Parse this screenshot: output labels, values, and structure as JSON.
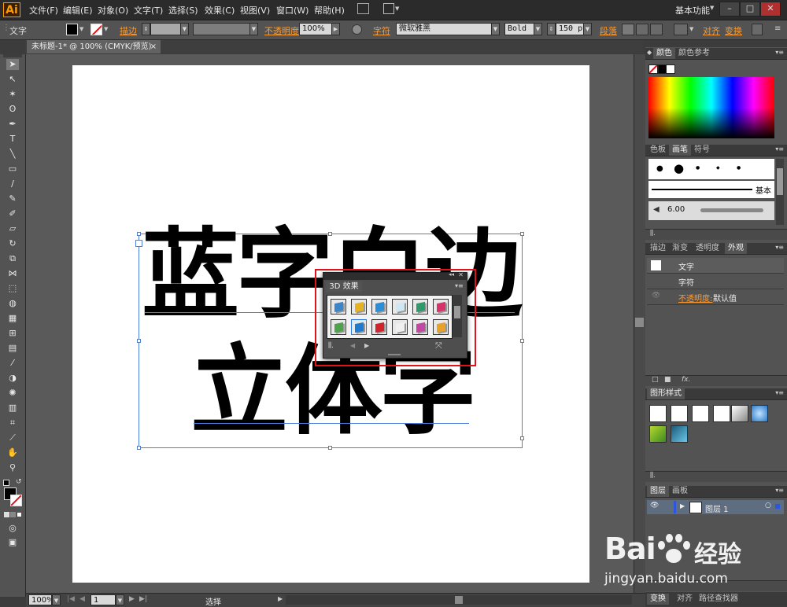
{
  "app": {
    "logo": "Ai",
    "menu": [
      "文件(F)",
      "编辑(E)",
      "对象(O)",
      "文字(T)",
      "选择(S)",
      "效果(C)",
      "视图(V)",
      "窗口(W)",
      "帮助(H)"
    ],
    "workspace": "基本功能",
    "window_buttons": [
      "–",
      "□",
      "✕"
    ]
  },
  "control_bar": {
    "type_label": "文字",
    "stroke_label": "描边",
    "opacity_label": "不透明度",
    "opacity_value": "100%",
    "char_label": "字符",
    "font_family": "微软雅黑",
    "font_style": "Bold",
    "font_size": "150 pt",
    "paragraph_label": "段落",
    "align_label": "对齐",
    "transform_label": "变换"
  },
  "document": {
    "tab_title": "未标题-1* @ 100% (CMYK/预览)",
    "tab_close": "×",
    "line1": "蓝字白边",
    "line2": "立体字"
  },
  "panel_3d": {
    "title": "3D 效果",
    "collapse": "◂◂",
    "close": "✕",
    "menu": "▾≡",
    "swatch_colors": [
      "#3a86c8",
      "#e3b321",
      "#2a8fd6",
      "#cfe6f3",
      "#2e9a6a",
      "#d6336c",
      "#4ea34a",
      "#1f7bd0",
      "#d2222a",
      "#f0f0f0",
      "#c248a3",
      "#e8a22a"
    ]
  },
  "status": {
    "zoom": "100%",
    "page": "1",
    "mode": "选择"
  },
  "right_panels": {
    "color_tabs": [
      "颜色",
      "颜色参考"
    ],
    "brush_tabs": [
      "色板",
      "画笔",
      "符号"
    ],
    "brush_basic": "基本",
    "brush_size": "6.00",
    "appearance_tabs": [
      "描边",
      "渐变",
      "透明度",
      "外观"
    ],
    "appearance_rows": [
      "文字",
      "字符"
    ],
    "opacity_label": "不透明度:",
    "opacity_value": "默认值",
    "fx": "fx.",
    "graphic_styles_tab": "图形样式",
    "layers_tabs": [
      "图层",
      "画板"
    ],
    "layer_name": "图层 1",
    "bottom_tabs": [
      "变换",
      "对齐",
      "路径查找器"
    ]
  },
  "watermark": {
    "logo_left": "Bai",
    "logo_right": "经验",
    "url": "jingyan.baidu.com"
  }
}
